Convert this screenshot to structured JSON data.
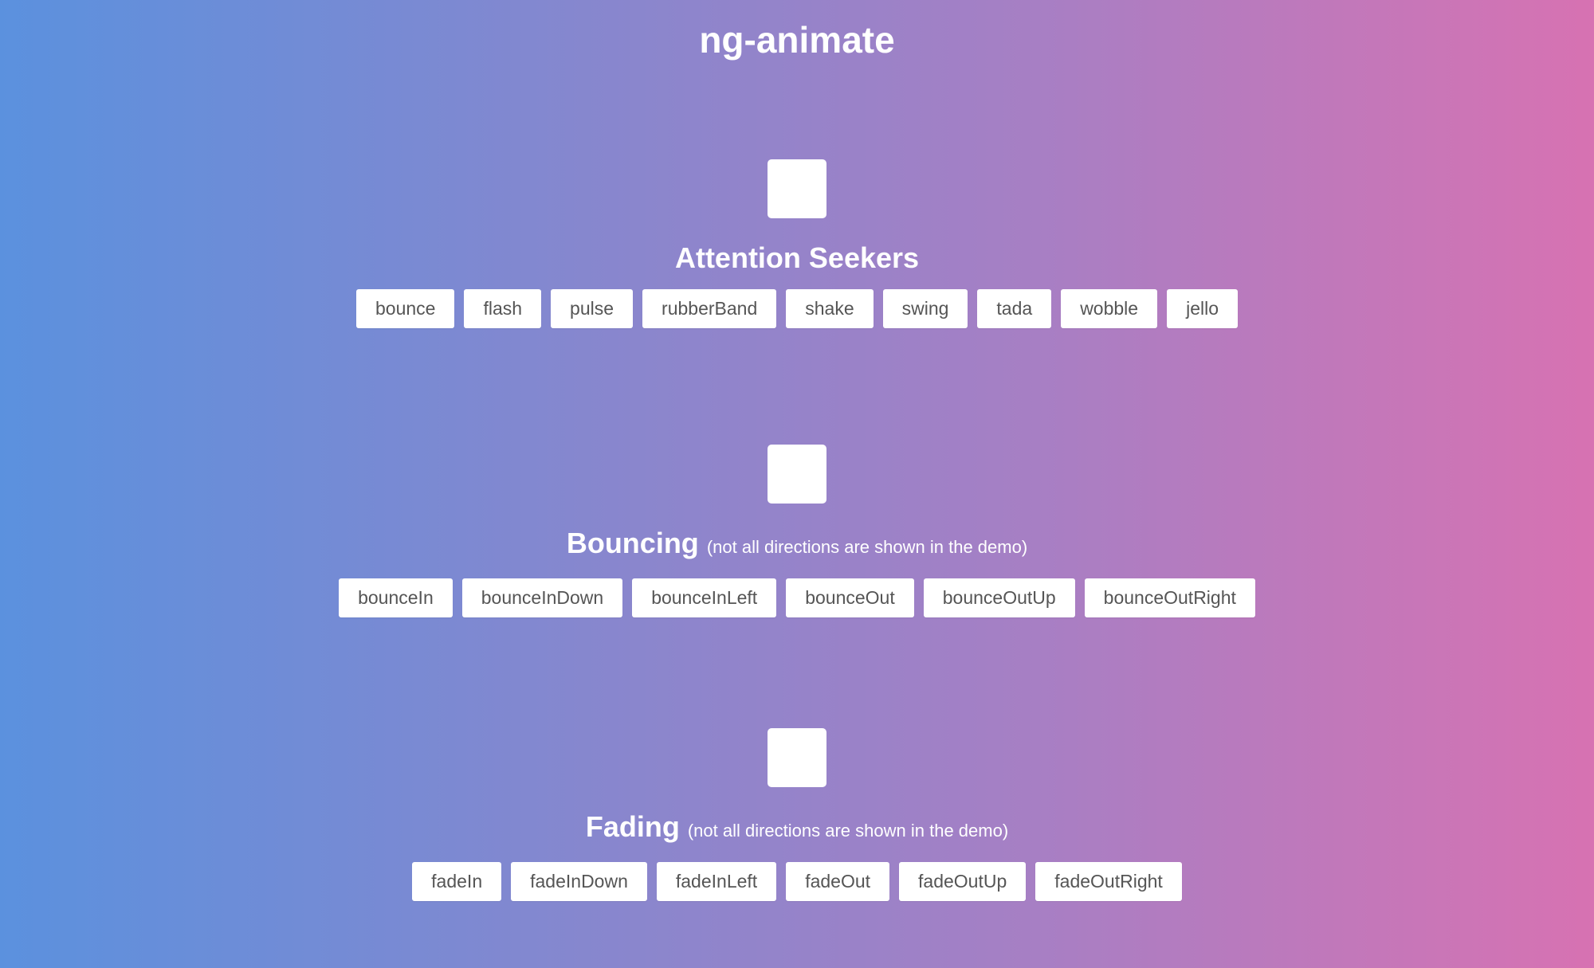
{
  "page": {
    "title": "ng-animate",
    "colors": {
      "gradient_start": "#5b91de",
      "gradient_end": "#d772b2",
      "button_bg": "#ffffff",
      "button_text": "#555555"
    }
  },
  "sections": [
    {
      "heading": "Attention Seekers",
      "note": "",
      "buttons": [
        "bounce",
        "flash",
        "pulse",
        "rubberBand",
        "shake",
        "swing",
        "tada",
        "wobble",
        "jello"
      ]
    },
    {
      "heading": "Bouncing",
      "note": "(not all directions are shown in the demo)",
      "buttons": [
        "bounceIn",
        "bounceInDown",
        "bounceInLeft",
        "bounceOut",
        "bounceOutUp",
        "bounceOutRight"
      ]
    },
    {
      "heading": "Fading",
      "note": "(not all directions are shown in the demo)",
      "buttons": [
        "fadeIn",
        "fadeInDown",
        "fadeInLeft",
        "fadeOut",
        "fadeOutUp",
        "fadeOutRight"
      ]
    }
  ]
}
